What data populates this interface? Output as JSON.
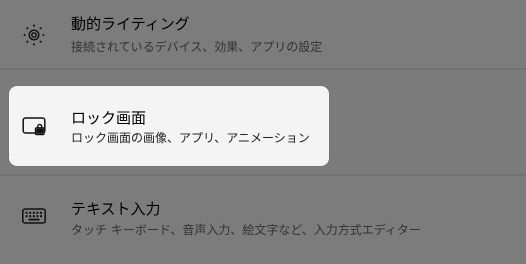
{
  "settings": {
    "items": [
      {
        "title": "動的ライティング",
        "subtitle": "接続されているデバイス、効果、アプリの設定",
        "icon": "dynamic-lighting-icon"
      },
      {
        "title": "ロック画面",
        "subtitle": "ロック画面の画像、アプリ、アニメーション",
        "icon": "lock-screen-icon"
      },
      {
        "title": "テキスト入力",
        "subtitle": "タッチ キーボード、音声入力、絵文字など、入力方式エディター",
        "icon": "keyboard-icon"
      }
    ]
  },
  "colors": {
    "overlay_background": "#7b7b7b",
    "highlight_background": "#f4f4f4",
    "text_primary": "#000000"
  }
}
